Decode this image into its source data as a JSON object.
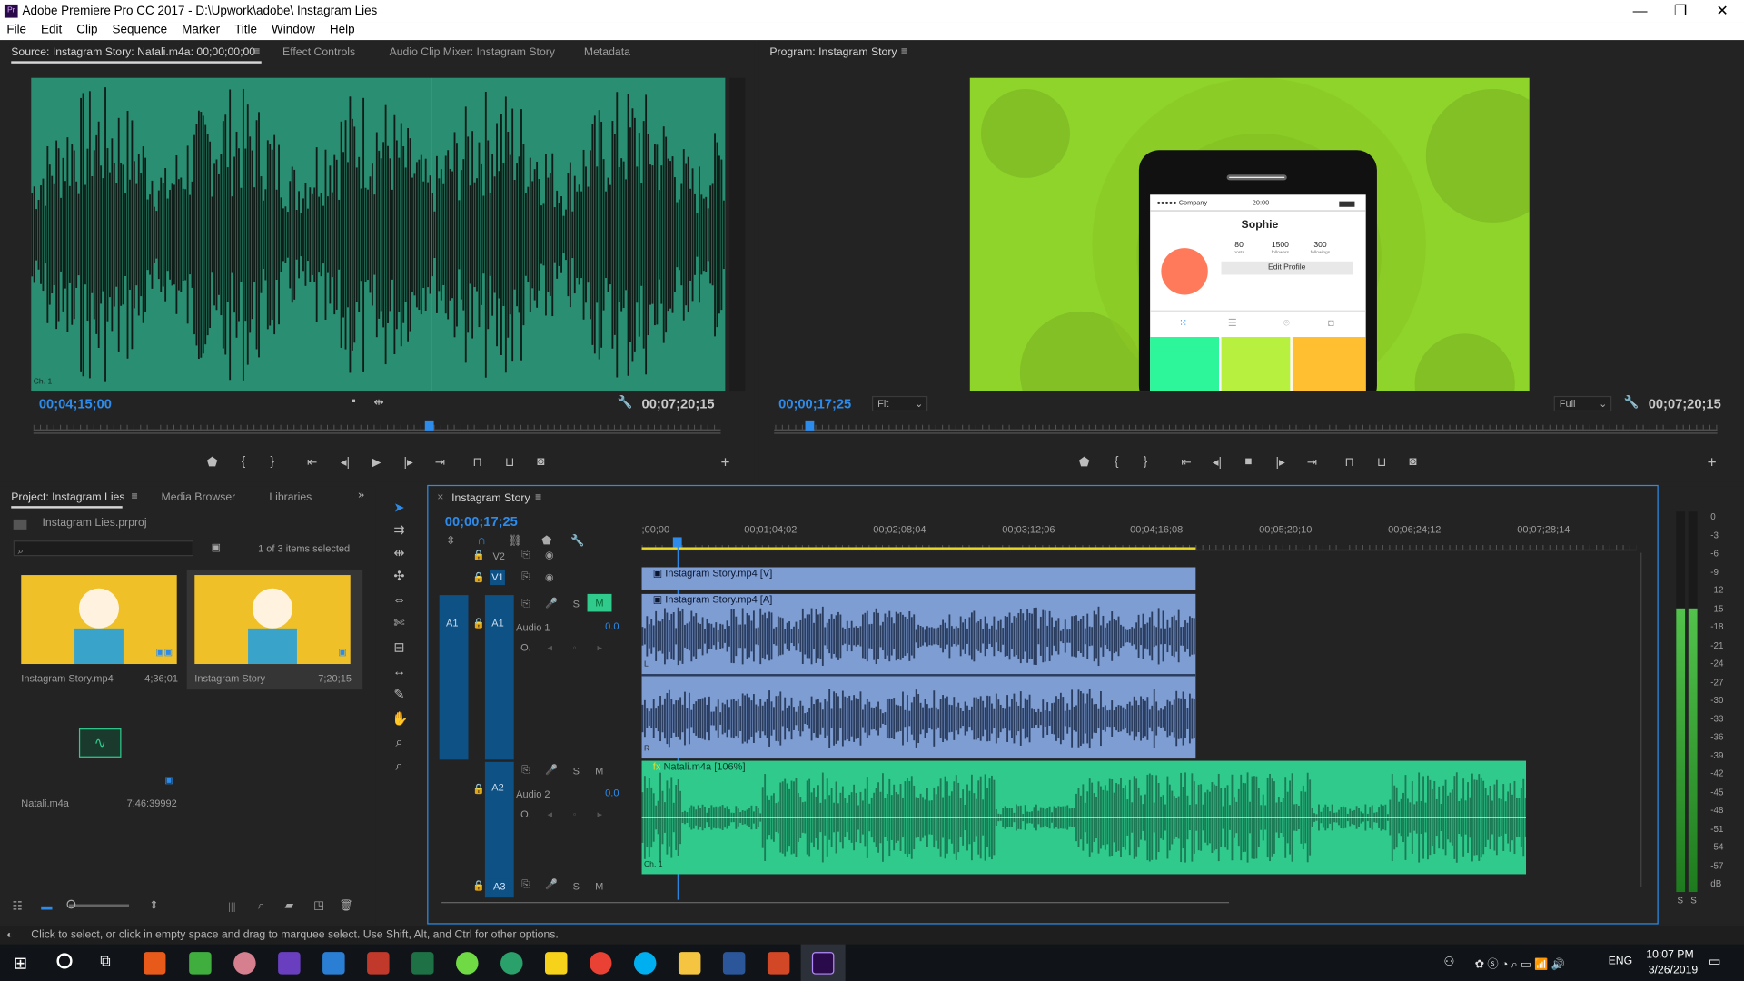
{
  "window": {
    "title": "Adobe Premiere Pro CC 2017 - D:\\Upwork\\adobe\\ Instagram Lies",
    "logo": "Pr"
  },
  "menu": [
    "File",
    "Edit",
    "Clip",
    "Sequence",
    "Marker",
    "Title",
    "Window",
    "Help"
  ],
  "source_panel": {
    "tabs": [
      "Source: Instagram Story: Natali.m4a: 00;00;00;00",
      "Effect Controls",
      "Audio Clip Mixer: Instagram Story",
      "Metadata"
    ],
    "channel_label": "Ch. 1",
    "current_tc": "00;04;15;00",
    "duration_tc": "00;07;20;15"
  },
  "program_panel": {
    "tab": "Program: Instagram Story",
    "current_tc": "00;00;17;25",
    "fit": "Fit",
    "quality": "Full",
    "duration_tc": "00;07;20;15",
    "phone": {
      "carrier": "●●●●● Company",
      "time": "20:00",
      "name": "Sophie",
      "stats": [
        {
          "n": "80",
          "l": "posts"
        },
        {
          "n": "1500",
          "l": "followers"
        },
        {
          "n": "300",
          "l": "followings"
        }
      ],
      "edit": "Edit Profile"
    }
  },
  "project_panel": {
    "tabs": [
      "Project: Instagram Lies",
      "Media Browser",
      "Libraries"
    ],
    "file": "Instagram Lies.prproj",
    "selection": "1 of 3 items selected",
    "items": [
      {
        "name": "Instagram Story.mp4",
        "dur": "4;36;01"
      },
      {
        "name": "Instagram Story",
        "dur": "7;20;15"
      },
      {
        "name": "Natali.m4a",
        "dur": "7:46:39992"
      }
    ]
  },
  "timeline": {
    "tab": "Instagram Story",
    "current_tc": "00;00;17;25",
    "ruler": [
      ";00;00",
      "00;01;04;02",
      "00;02;08;04",
      "00;03;12;06",
      "00;04;16;08",
      "00;05;20;10",
      "00;06;24;12",
      "00;07;28;14"
    ],
    "tracks": {
      "v2": "V2",
      "v1": "V1",
      "a1": "A1",
      "a2": "A2",
      "a3": "A3",
      "audio1": "Audio 1",
      "audio2": "Audio 2",
      "vol1": "0.0",
      "vol2": "0.0",
      "s": "S",
      "m": "M",
      "ch_l": "L",
      "ch_r": "R",
      "ch1": "Ch. 1",
      "fx": "fx"
    },
    "clips": {
      "video": "Instagram Story.mp4 [V]",
      "audio": "Instagram Story.mp4 [A]",
      "natali": "Natali.m4a [106%]"
    }
  },
  "meter": {
    "labels": [
      "0",
      "-3",
      "-6",
      "-9",
      "-12",
      "-15",
      "-18",
      "-21",
      "-24",
      "-27",
      "-30",
      "-33",
      "-36",
      "-39",
      "-42",
      "-45",
      "-48",
      "-51",
      "-54",
      "-57",
      "dB"
    ],
    "solo": "S"
  },
  "status_bar": "Click to select, or click in empty space and drag to marquee select. Use Shift, Alt, and Ctrl for other options.",
  "taskbar": {
    "lang": "ENG",
    "time": "10:07 PM",
    "date": "3/26/2019"
  },
  "colors": {
    "accent": "#2d8ceb",
    "audio_green": "#2fca8c",
    "clip_blue": "#7e9dd2",
    "program_bg": "#8fd42a"
  }
}
